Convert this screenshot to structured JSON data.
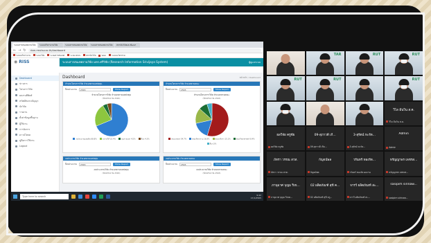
{
  "browser": {
    "tabs": [
      "ระบบสารสนเทศงานวิจัย",
      "ระบบบริหารงานวิจัย",
      "ระบบสารสนเทศงานวิจัย",
      "ระบบสารสนเทศงานวิจัย",
      "สถาบันวิจัยและพัฒนา"
    ],
    "url": "rism.rmutsv.ac.th/dashboard",
    "bookmarks": [
      "ระบบบริหารงาน",
      "ระบบวิจัย",
      "ระบบสารสนเทศ",
      "ระบบ RISS",
      "สถาบันวิจัย",
      "Web",
      "ระบบนวัตกรรม"
    ]
  },
  "app": {
    "logo": "RISS",
    "title": "ระบบสารสนเทศงานวิจัย มทร.ศรีวิชัย (Research Information Srivijaya System)",
    "user": "ผู้ดูแลระบบ",
    "page_title": "Dashboard",
    "breadcrumb": "หน้าหลัก / Dashboard",
    "sidebar": [
      "Dashboard",
      "ข่าวสาร",
      "โครงการวิจัย",
      "ผลงานตีพิมพ์",
      "ทรัพย์สินทางปัญญา",
      "นักวิจัย",
      "รายงาน",
      "ตั้งค่าข้อมูลพื้นฐาน",
      "ผู้ใช้งาน",
      "การจัดการ",
      "ดาวน์โหลด",
      "คู่มือการใช้งาน",
      "Logout"
    ]
  },
  "cards": [
    {
      "header": "จำนวนโครงการวิจัย จำแนกตามแหล่งทุน",
      "filter_label": "ปีงบประมาณ",
      "filter_value": "2565",
      "button": "Show Report",
      "title": "จำนวนโครงการวิจัย จำแนกตามแหล่งทุน",
      "subtitle": "(ปีงบประมาณ 2565)"
    },
    {
      "header": "จำนวนโครงการวิจัย จำแนกตามคณะ",
      "filter_label": "ปีงบประมาณ",
      "filter_value": "2565",
      "button": "Show Report",
      "title": "จำนวนโครงการวิจัย จำแนกตามคณะ",
      "subtitle": "(ปีงบประมาณ 2565)"
    },
    {
      "header": "งบประมาณวิจัย จำแนกตามแหล่งทุน",
      "filter_label": "ปีงบประมาณ",
      "filter_value": "2565",
      "button": "Show Report",
      "title": "งบประมาณวิจัย จำแนกตามแหล่งทุน",
      "subtitle": "(ปีงบประมาณ 2565)"
    },
    {
      "header": "งบประมาณวิจัย จำแนกตามคณะ",
      "filter_label": "ปีงบประมาณ",
      "filter_value": "2565",
      "button": "Show Report",
      "title": "งบประมาณวิจัย จำแนกตามคณะ",
      "subtitle": "(ปีงบประมาณ 2565)"
    }
  ],
  "chart_data": [
    {
      "type": "pie",
      "slices": [
        {
          "label": "งบประมาณแผ่นดิน",
          "value": 68.8,
          "color": "#2f7fd1"
        },
        {
          "label": "งบรายได้",
          "value": 22.4,
          "color": "#8dc63f"
        },
        {
          "label": "ทุนภายนอก",
          "value": 4.5,
          "color": "#1b6e35"
        },
        {
          "label": "อื่นๆ",
          "value": 4.3,
          "color": "#7a4a1d"
        }
      ]
    },
    {
      "type": "pie",
      "slices": [
        {
          "label": "คณะเกษตร",
          "value": 54.7,
          "color": "#a31b1b"
        },
        {
          "label": "คณะวิศวกรรม",
          "value": 16.8,
          "color": "#2f7fd1"
        },
        {
          "label": "คณะบริหาร",
          "value": 15.1,
          "color": "#9ab84a"
        },
        {
          "label": "คณะวิทยาศาสตร์",
          "value": 8.4,
          "color": "#1b6e35"
        },
        {
          "label": "อื่นๆ",
          "value": 5.0,
          "color": "#45b0c9"
        }
      ]
    }
  ],
  "taskbar": {
    "search_placeholder": "Type here to search",
    "time": "9:42",
    "date": "17/1/2565"
  },
  "participants": [
    {
      "name": "",
      "label": "",
      "video": true,
      "style": "dark"
    },
    {
      "name": "",
      "label": "",
      "video": true,
      "style": "hair",
      "rut": "TAR"
    },
    {
      "name": "",
      "label": "",
      "video": true,
      "style": "hair",
      "rut": "RUT"
    },
    {
      "name": "",
      "label": "",
      "video": true,
      "style": "mask",
      "rut": "RUT"
    },
    {
      "name": "",
      "label": "",
      "video": true,
      "style": "hair",
      "rut": "RUT"
    },
    {
      "name": "",
      "label": "",
      "video": true,
      "style": "hair",
      "rut": "RUT"
    },
    {
      "name": "",
      "label": "",
      "video": true,
      "style": "hair"
    },
    {
      "name": "",
      "label": "",
      "video": true,
      "style": "mask",
      "rut": "RUT"
    },
    {
      "name": "",
      "label": "",
      "video": true,
      "style": "mask"
    },
    {
      "name": "",
      "label": "",
      "video": true,
      "style": "dark"
    },
    {
      "name": "",
      "label": "",
      "video": true,
      "style": "hair"
    },
    {
      "name": "วิไล มีนวิน ส.ค.",
      "label": "วิไล มีนวิน ส.ค.",
      "video": false
    },
    {
      "name": "ผลวิจัย ครูชัย",
      "label": "ผลวิจัย ครูชัย",
      "video": false
    },
    {
      "name": "09-สุภาวดี เกี...",
      "label": "09-สุภาวดี เกีย...",
      "video": false
    },
    {
      "name": "3-สุรัตน์ หะรัต...",
      "label": "3-สุรัตน์ หะรัต...",
      "video": false
    },
    {
      "name": "Admin",
      "label": "Admin",
      "video": false
    },
    {
      "name": "ภัทรา วรรณ สวท.",
      "label": "ภัทรา วรรณ สวท.",
      "video": false
    },
    {
      "name": "กัญจน์พล",
      "label": "กัญจน์พล",
      "video": false
    },
    {
      "name": "วรันทร์ ทองรัต...",
      "label": "วรันทร์ ทองรัต ผลงาน",
      "video": false
    },
    {
      "name": "หรัญญาพร เพชรส...",
      "label": "หรัญญาพร เพชรส...",
      "video": false
    },
    {
      "name": "ภานุมาศ บุญม ริเข...",
      "label": "ภานุมาศ บุญม ริเขต...",
      "video": false
    },
    {
      "name": "02 ผลิตภัณฑ์ สุขี ค...",
      "label": "02 ผลิตภัณฑ์ สุขี ครู...",
      "video": false
    },
    {
      "name": "จารวี ผลิตภัณฑ์ สะ...",
      "label": "จารวี ผลิตภัณฑ์ สะ...",
      "video": false
    },
    {
      "name": "sasipim sirinaw...",
      "label": "sasipim sirinaw...",
      "video": false
    }
  ]
}
